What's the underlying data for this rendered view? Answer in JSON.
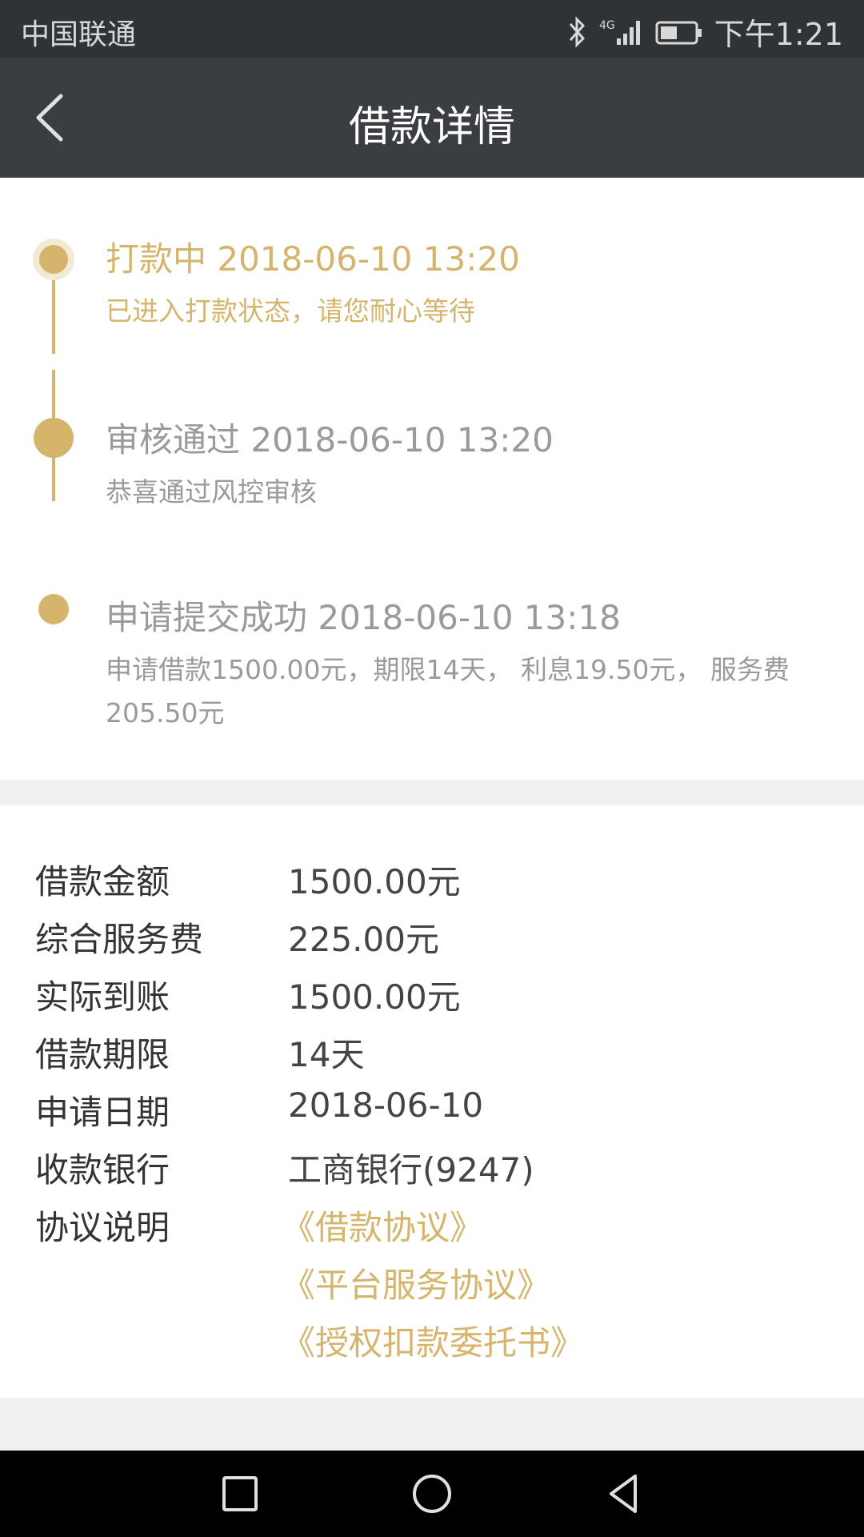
{
  "status_bar": {
    "carrier": "中国联通",
    "time": "下午1:21",
    "network": "4G"
  },
  "header": {
    "title": "借款详情"
  },
  "timeline": [
    {
      "title": "打款中 2018-06-10 13:20",
      "desc": "已进入打款状态，请您耐心等待",
      "state": "current"
    },
    {
      "title": "审核通过 2018-06-10 13:20",
      "desc": "恭喜通过风控审核",
      "state": "done"
    },
    {
      "title": "申请提交成功 2018-06-10 13:18",
      "desc": "申请借款1500.00元，期限14天， 利息19.50元， 服务费205.50元",
      "state": "done"
    }
  ],
  "details": [
    {
      "label": "借款金额",
      "value": "1500.00元"
    },
    {
      "label": "综合服务费",
      "value": "225.00元"
    },
    {
      "label": "实际到账",
      "value": "1500.00元"
    },
    {
      "label": "借款期限",
      "value": "14天"
    },
    {
      "label": "申请日期",
      "value": "2018-06-10"
    },
    {
      "label": "收款银行",
      "value": "工商银行(9247)"
    }
  ],
  "agreements": {
    "label": "协议说明",
    "links": [
      "《借款协议》",
      "《平台服务协议》",
      "《授权扣款委托书》"
    ]
  },
  "colors": {
    "accent": "#d5b46c",
    "nav_bg": "#3a3d41",
    "status_bg": "#303336"
  }
}
